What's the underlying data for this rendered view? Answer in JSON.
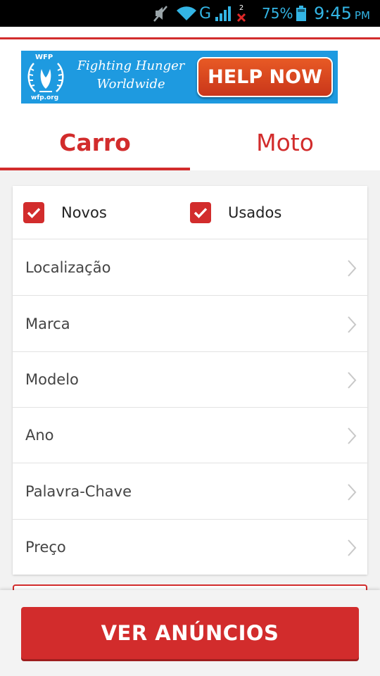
{
  "status_bar": {
    "network": "G",
    "sim_badge": "2",
    "battery": "75%",
    "time": "9:45",
    "ampm": "PM"
  },
  "ad": {
    "org_top": "WFP",
    "org_bottom": "wfp.org",
    "tagline_1": "Fighting Hunger",
    "tagline_2": "Worldwide",
    "cta": "HELP NOW"
  },
  "tabs": [
    {
      "label": "Carro",
      "active": true
    },
    {
      "label": "Moto",
      "active": false
    }
  ],
  "filters": {
    "checkboxes": [
      {
        "label": "Novos",
        "checked": true
      },
      {
        "label": "Usados",
        "checked": true
      }
    ],
    "rows": [
      {
        "label": "Localização"
      },
      {
        "label": "Marca"
      },
      {
        "label": "Modelo"
      },
      {
        "label": "Ano"
      },
      {
        "label": "Palavra-Chave"
      },
      {
        "label": "Preço"
      }
    ]
  },
  "action": {
    "label": "VER ANÚNCIOS"
  },
  "colors": {
    "accent": "#d22c2c",
    "status_icon": "#33b5e5",
    "ad_background": "#1e9ae0"
  }
}
